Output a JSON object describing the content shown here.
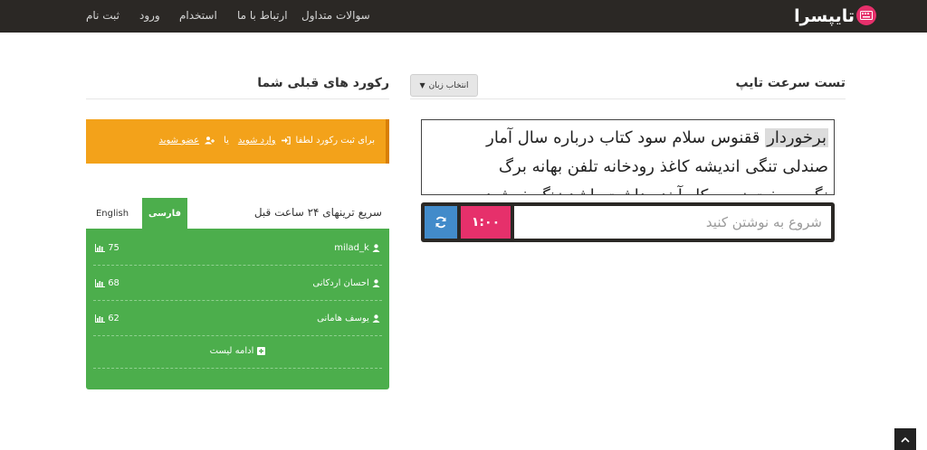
{
  "nav": {
    "signup": "ثبت نام",
    "login": "ورود",
    "hiring": "استخدام",
    "contact": "ارتباط با ما",
    "faq": "سوالات متداول",
    "brand": "تایپسرا"
  },
  "typing_test": {
    "title": "تست سرعت تایپ",
    "lang_button": "انتخاب زبان",
    "active_word": "برخوردار",
    "line1_rest": " ققنوس سلام سود کتاب درباره سال آمار",
    "line2": "صندلی تنگی اندیشه کاغذ رودخانه تلفن بهانه برگ",
    "line3": "نگر سوخت زمین کار آینده داشت باشد زنگ خوشید",
    "input_placeholder": "شروع به نوشتن کنید",
    "timer": "۱:۰۰"
  },
  "records": {
    "title": "رکورد های قبلی شما",
    "alert_prefix": "برای ثبت رکورد لطفا",
    "login_link": "وارد شوید",
    "or": "یا",
    "register_link": "عضو شوید"
  },
  "leaderboard": {
    "title": "سریع ترینهای ۲۴ ساعت قبل",
    "tab_fa": "فارسی",
    "tab_en": "English",
    "rows": [
      {
        "user": "milad_k",
        "score": "75"
      },
      {
        "user": "احسان اردکانی",
        "score": "68"
      },
      {
        "user": "یوسف هامانی",
        "score": "62"
      }
    ],
    "more": "ادامه لیست"
  },
  "colors": {
    "navbar": "#2b2825",
    "brand_pink": "#e6306b",
    "alert_orange": "#f3a21a",
    "leaderboard_green": "#4cae4c",
    "refresh_blue": "#428bca"
  }
}
